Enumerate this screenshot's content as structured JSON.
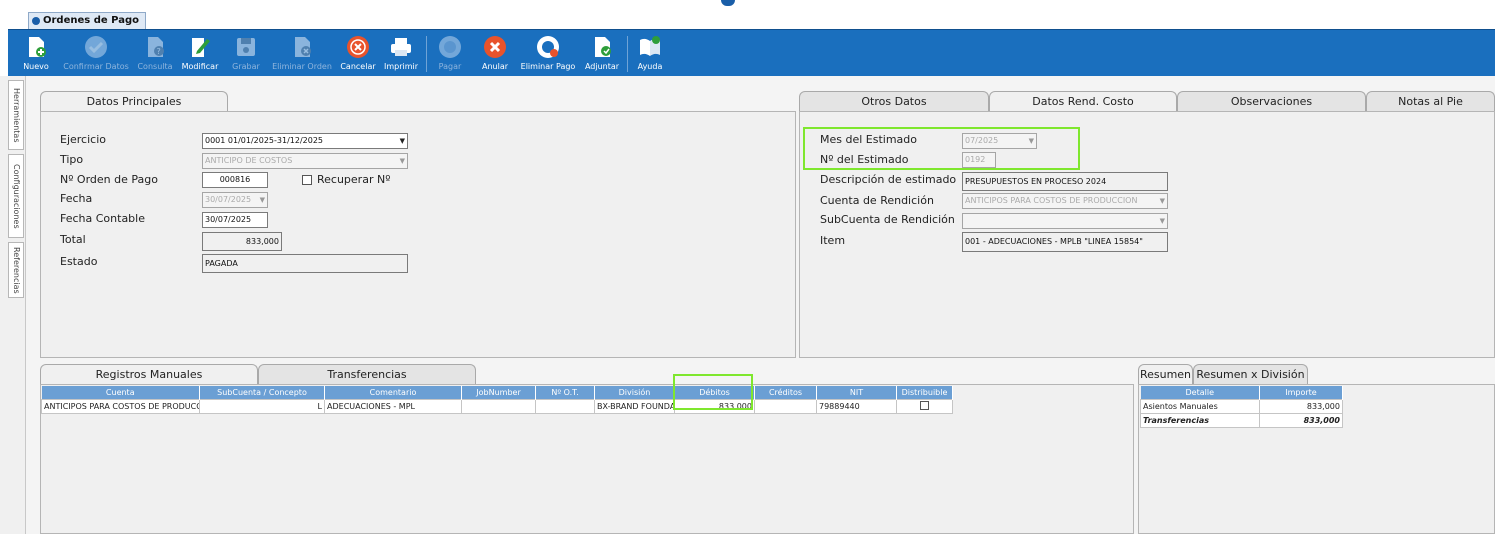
{
  "window": {
    "tab_title": "Ordenes de Pago"
  },
  "colors": {
    "toolbar": "#1a6fbe",
    "highlight": "#7fe72e",
    "grid_header": "#6b9fd4"
  },
  "toolbar": {
    "nuevo": "Nuevo",
    "confirmar": "Confirmar Datos",
    "consulta": "Consulta",
    "modificar": "Modificar",
    "grabar": "Grabar",
    "eliminar_orden": "Eliminar Orden",
    "cancelar": "Cancelar",
    "imprimir": "Imprimir",
    "pagar": "Pagar",
    "anular": "Anular",
    "eliminar_pago": "Eliminar Pago",
    "adjuntar": "Adjuntar",
    "ayuda": "Ayuda"
  },
  "sidebar": {
    "herramientas": "Herramientas",
    "configuraciones": "Configuraciones",
    "referencias": "Referencias"
  },
  "left_panel": {
    "tab": "Datos Principales",
    "labels": {
      "ejercicio": "Ejercicio",
      "tipo": "Tipo",
      "nro_orden": "Nº Orden de Pago",
      "fecha": "Fecha",
      "fecha_contable": "Fecha Contable",
      "total": "Total",
      "estado": "Estado"
    },
    "values": {
      "ejercicio": "0001 01/01/2025-31/12/2025",
      "tipo": "ANTICIPO DE COSTOS",
      "nro_orden": "000816",
      "fecha": "30/07/2025",
      "fecha_contable": "30/07/2025",
      "total": "833,000",
      "estado": "PAGADA"
    },
    "recuperar": "Recuperar Nº"
  },
  "right_panel": {
    "tabs": [
      "Otros Datos",
      "Datos Rend. Costo",
      "Observaciones",
      "Notas al Pie"
    ],
    "labels": {
      "mes": "Mes del Estimado",
      "nro_estimado": "Nº del Estimado",
      "descripcion": "Descripción de estimado",
      "cuenta": "Cuenta de Rendición",
      "subcuenta": "SubCuenta de Rendición",
      "item": "Item"
    },
    "values": {
      "mes": "07/2025",
      "nro_estimado": "0192",
      "descripcion": "PRESUPUESTOS EN PROCESO 2024",
      "cuenta": "ANTICIPOS PARA COSTOS DE PRODUCCION",
      "subcuenta": "",
      "item": "001 - ADECUACIONES   - MPLB \"LINEA 15854\""
    }
  },
  "bottom_left": {
    "tabs": [
      "Registros Manuales",
      "Transferencias"
    ],
    "columns": [
      "Cuenta",
      "SubCuenta / Concepto",
      "Comentario",
      "JobNumber",
      "Nº O.T.",
      "División",
      "Débitos",
      "Créditos",
      "NIT",
      "Distribuible"
    ],
    "rows": [
      {
        "cuenta": "ANTICIPOS PARA COSTOS DE PRODUCC",
        "subcuenta": "L",
        "comentario": "ADECUACIONES  - MPL",
        "jobnumber": "",
        "ot": "",
        "division": "BX-BRAND FOUNDA",
        "debitos": "833,000",
        "creditos": "",
        "nit": "79889440",
        "distribuible": ""
      }
    ]
  },
  "bottom_right": {
    "tabs": [
      "Resumen",
      "Resumen x División"
    ],
    "columns": [
      "Detalle",
      "Importe"
    ],
    "rows": [
      {
        "detalle": "Asientos Manuales",
        "importe": "833,000"
      },
      {
        "detalle": "Transferencias",
        "importe": "833,000"
      }
    ]
  }
}
